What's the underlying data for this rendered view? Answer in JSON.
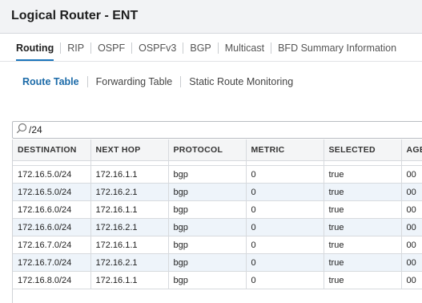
{
  "window": {
    "title": "Logical Router - ENT"
  },
  "main_tabs": [
    "Routing",
    "RIP",
    "OSPF",
    "OSPFv3",
    "BGP",
    "Multicast",
    "BFD Summary Information"
  ],
  "sub_tabs": [
    "Route Table",
    "Forwarding Table",
    "Static Route Monitoring"
  ],
  "search": {
    "value": "/24",
    "icon": "search-icon"
  },
  "table": {
    "headers": [
      "DESTINATION",
      "NEXT HOP",
      "PROTOCOL",
      "METRIC",
      "SELECTED",
      "AGE"
    ],
    "rows": [
      [
        "172.16.5.0/24",
        "172.16.1.1",
        "bgp",
        "0",
        "true",
        "00"
      ],
      [
        "172.16.5.0/24",
        "172.16.2.1",
        "bgp",
        "0",
        "true",
        "00"
      ],
      [
        "172.16.6.0/24",
        "172.16.1.1",
        "bgp",
        "0",
        "true",
        "00"
      ],
      [
        "172.16.6.0/24",
        "172.16.2.1",
        "bgp",
        "0",
        "true",
        "00"
      ],
      [
        "172.16.7.0/24",
        "172.16.1.1",
        "bgp",
        "0",
        "true",
        "00"
      ],
      [
        "172.16.7.0/24",
        "172.16.2.1",
        "bgp",
        "0",
        "true",
        "00"
      ],
      [
        "172.16.8.0/24",
        "172.16.1.1",
        "bgp",
        "0",
        "true",
        "00"
      ]
    ]
  },
  "colors": {
    "accent": "#1b75bb",
    "row_alt": "#eef4fa",
    "header_bg": "#f4f5f6"
  }
}
